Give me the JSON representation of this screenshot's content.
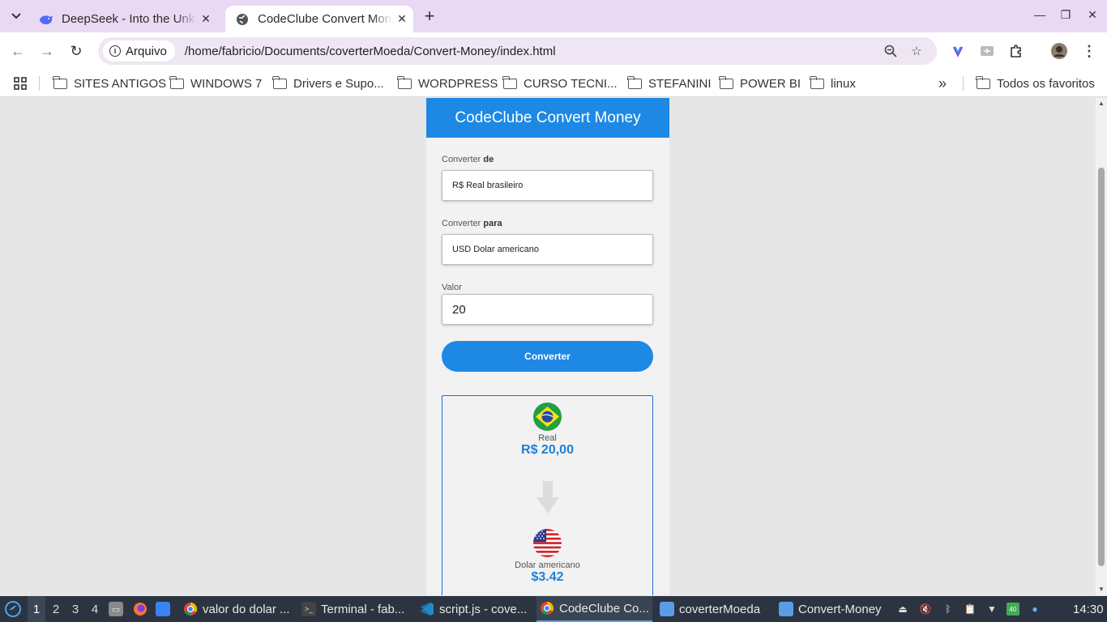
{
  "browser": {
    "tabs": [
      {
        "title": "DeepSeek - Into the Unknown",
        "favicon": "deepseek-whale-icon"
      },
      {
        "title": "CodeClube Convert Money",
        "favicon": "globe-icon"
      }
    ],
    "address": {
      "chip_label": "Arquivo",
      "url": "/home/fabricio/Documents/coverterMoeda/Convert-Money/index.html"
    },
    "bookmarks": [
      "SITES ANTIGOS",
      "WINDOWS 7",
      "Drivers e Supo...",
      "WORDPRESS",
      "CURSO TECNI...",
      "STEFANINI",
      "POWER BI",
      "linux"
    ],
    "bookmarks_overflow": "»",
    "all_bookmarks": "Todos os favoritos"
  },
  "app": {
    "header": "CodeClube Convert Money",
    "from_label_prefix": "Converter ",
    "from_label_bold": "de",
    "from_value": "R$ Real brasileiro",
    "to_label_prefix": "Converter ",
    "to_label_bold": "para",
    "to_value": "USD Dolar americano",
    "amount_label": "Valor",
    "amount_value": "20",
    "button": "Converter",
    "result": {
      "from_name": "Real",
      "from_value": "R$ 20,00",
      "to_name": "Dolar americano",
      "to_value": "$3.42"
    }
  },
  "taskbar": {
    "workspaces": [
      "1",
      "2",
      "3",
      "4"
    ],
    "items": [
      {
        "label": "valor do dolar ...",
        "icon": "chrome-icon"
      },
      {
        "label": "Terminal - fab...",
        "icon": "terminal-icon"
      },
      {
        "label": "script.js - cove...",
        "icon": "vscode-icon"
      },
      {
        "label": "CodeClube Co...",
        "icon": "chrome-icon"
      },
      {
        "label": "coverterMoeda",
        "icon": "folder-icon"
      },
      {
        "label": "Convert-Money",
        "icon": "folder-icon"
      }
    ],
    "clock": "14:30",
    "battery_badge": "40"
  },
  "colors": {
    "accent": "#1e88e5",
    "tabstrip": "#ead9f3",
    "taskbar": "#2b3440"
  }
}
